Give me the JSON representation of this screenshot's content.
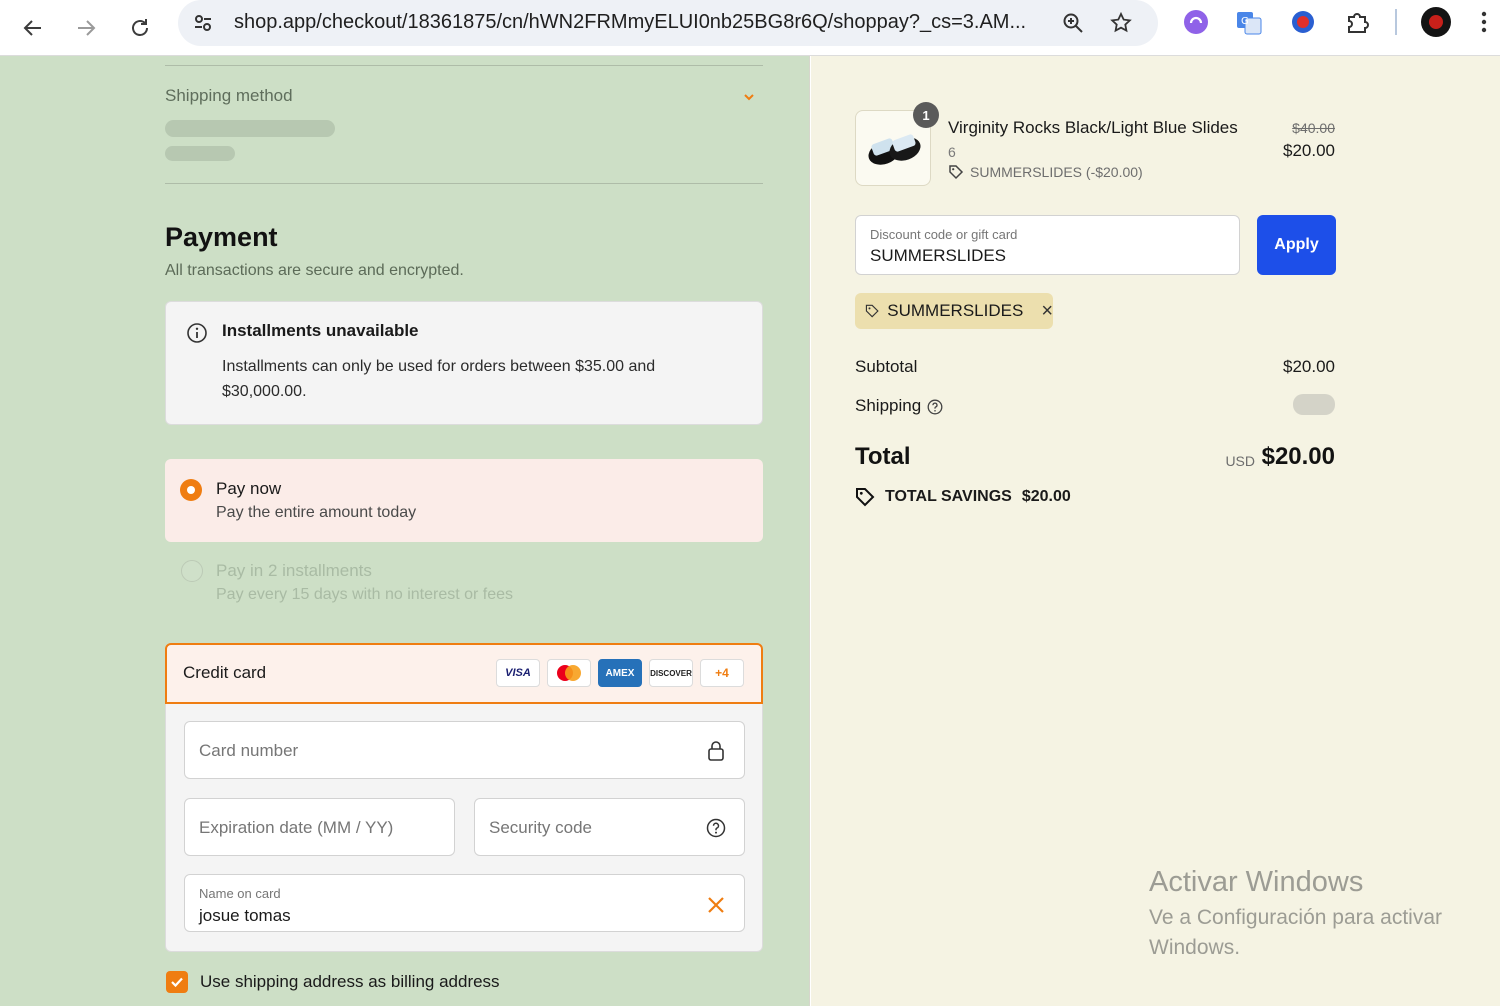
{
  "browser": {
    "url": "shop.app/checkout/18361875/cn/hWN2FRMmyELUI0nb25BG8r6Q/shoppay?_cs=3.AM..."
  },
  "checkout": {
    "shipping_method_label": "Shipping method",
    "payment_title": "Payment",
    "payment_subtitle": "All transactions are secure and encrypted.",
    "installments_notice": {
      "title": "Installments unavailable",
      "text": "Installments can only be used for orders between $35.00 and $30,000.00."
    },
    "payment_options": [
      {
        "title": "Pay now",
        "subtitle": "Pay the entire amount today",
        "selected": true
      },
      {
        "title": "Pay in 2 installments",
        "subtitle": "Pay every 15 days with no interest or fees",
        "selected": false
      }
    ],
    "credit_card": {
      "label": "Credit card",
      "brands": [
        "VISA",
        "MASTERCARD",
        "AMEX",
        "DISCOVER"
      ],
      "more_brands": "+4",
      "card_number_placeholder": "Card number",
      "expiration_placeholder": "Expiration date (MM / YY)",
      "security_code_placeholder": "Security code",
      "name_label": "Name on card",
      "name_value": "josue tomas"
    },
    "billing_checkbox_label": "Use shipping address as billing address",
    "billing_checkbox_checked": true
  },
  "summary": {
    "item": {
      "quantity": "1",
      "name": "Virginity Rocks Black/Light Blue Slides",
      "variant": "6",
      "discount": "SUMMERSLIDES (-$20.00)",
      "original_price": "$40.00",
      "price": "$20.00"
    },
    "discount_input": {
      "label": "Discount code or gift card",
      "value": "SUMMERSLIDES"
    },
    "apply_label": "Apply",
    "applied_code": "SUMMERSLIDES",
    "subtotal_label": "Subtotal",
    "subtotal_value": "$20.00",
    "shipping_label": "Shipping",
    "total_label": "Total",
    "currency": "USD",
    "total_value": "$20.00",
    "savings_label": "TOTAL SAVINGS",
    "savings_value": "$20.00"
  },
  "watermark": {
    "title": "Activar Windows",
    "subtitle": "Ve a Configuración para activar Windows."
  },
  "colors": {
    "left_background": "#cddfc6",
    "right_background": "#f5f3e3",
    "accent": "#ef7d11",
    "apply_button": "#1d4fe9"
  }
}
